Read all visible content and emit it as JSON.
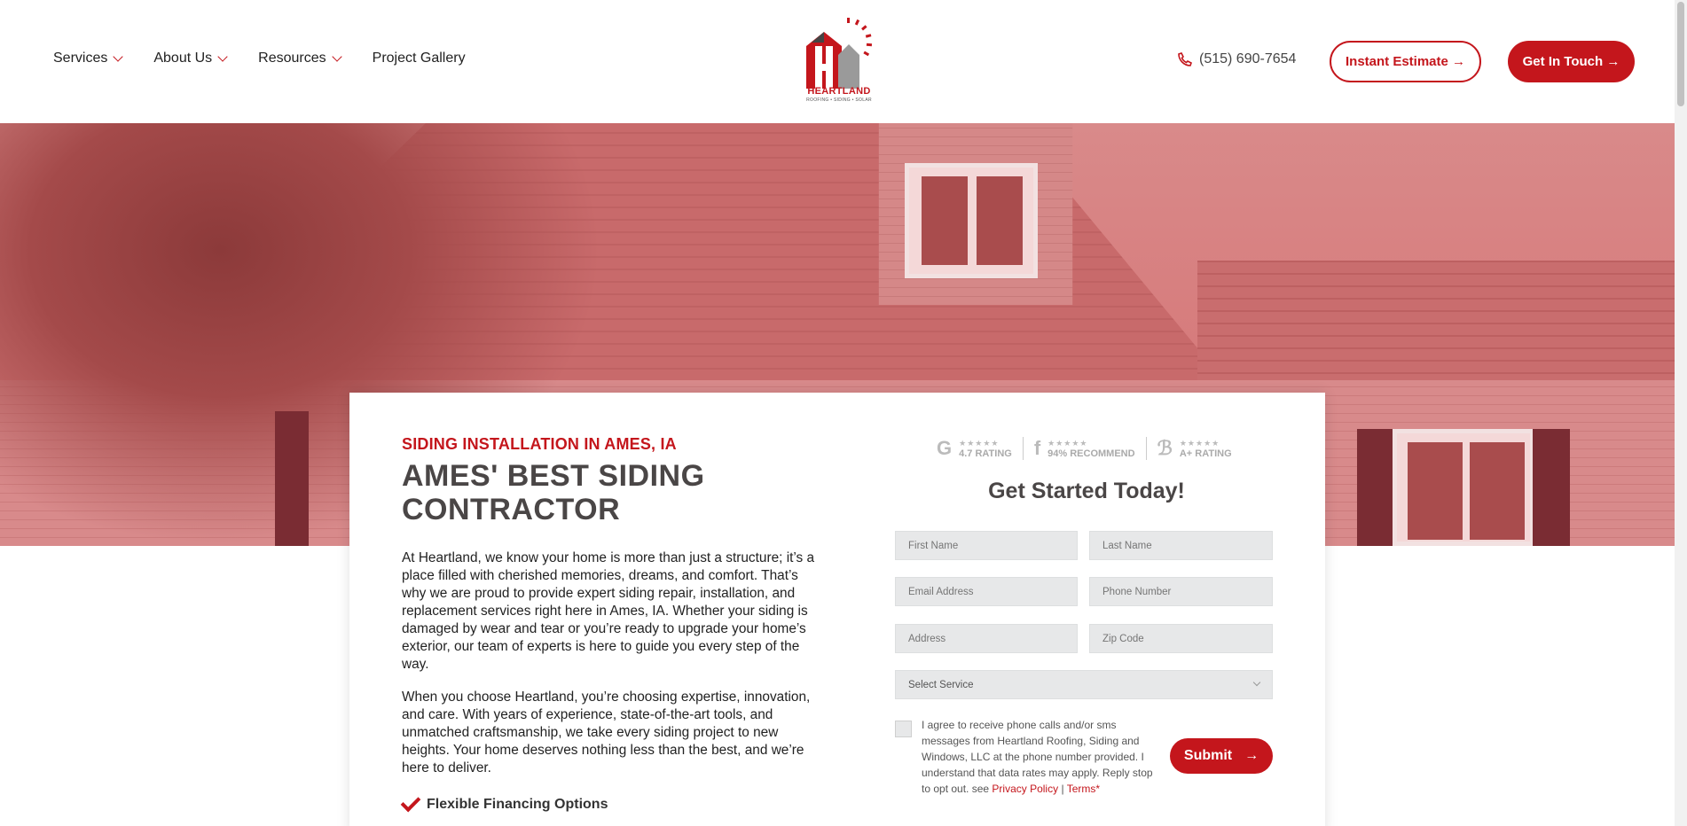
{
  "header": {
    "nav": [
      {
        "label": "Services",
        "dropdown": true
      },
      {
        "label": "About Us",
        "dropdown": true
      },
      {
        "label": "Resources",
        "dropdown": true
      },
      {
        "label": "Project Gallery",
        "dropdown": false
      }
    ],
    "logo": {
      "name": "HEARTLAND",
      "tagline": "ROOFING • SIDING • SOLAR"
    },
    "phone": "(515) 690-7654",
    "instant_estimate": "Instant Estimate →",
    "get_in_touch": "Get In Touch →"
  },
  "content": {
    "eyebrow": "SIDING INSTALLATION IN AMES, IA",
    "title": "AMES' BEST SIDING CONTRACTOR",
    "paragraph1": "At Heartland, we know your home is more than just a structure; it’s a place filled with cherished memories, dreams, and comfort. That’s why we are proud to provide expert siding repair, installation, and replacement services right here in Ames, IA. Whether your siding is damaged by wear and tear or you’re ready to upgrade your home’s exterior, our team of experts is here to guide you every step of the way.",
    "paragraph2": "When you choose Heartland, you’re choosing expertise, innovation, and care. With years of experience, state-of-the-art tools, and unmatched craftsmanship, we take every siding project to new heights. Your home deserves nothing less than the best, and we’re here to deliver.",
    "features": [
      "Flexible Financing Options"
    ]
  },
  "form": {
    "ratings": [
      {
        "icon": "google-icon",
        "glyph": "G",
        "stars": "★★★★★",
        "label": "4.7 RATING"
      },
      {
        "icon": "facebook-icon",
        "glyph": "f",
        "stars": "★★★★★",
        "label": "94% RECOMMEND"
      },
      {
        "icon": "bbb-icon",
        "glyph": "ℬ",
        "stars": "★★★★★",
        "label": "A+ RATING"
      }
    ],
    "title": "Get Started Today!",
    "first_name": "First Name",
    "last_name": "Last Name",
    "email": "Email Address",
    "phone": "Phone Number",
    "address": "Address",
    "zip": "Zip Code",
    "service": "Select Service",
    "consent_text": "I agree to receive phone calls and/or sms messages from Heartland Roofing, Siding and Windows, LLC at the phone number provided. I understand that data rates may apply. Reply stop to opt out. see",
    "privacy": "Privacy Policy",
    "separator": "|",
    "terms": "Terms",
    "required": "*",
    "submit": "Submit",
    "submit_arrow": "→"
  },
  "colors": {
    "brand_red": "#c4161c",
    "hero_tint": "#d46f70",
    "field_bg": "#e7e8e9"
  }
}
